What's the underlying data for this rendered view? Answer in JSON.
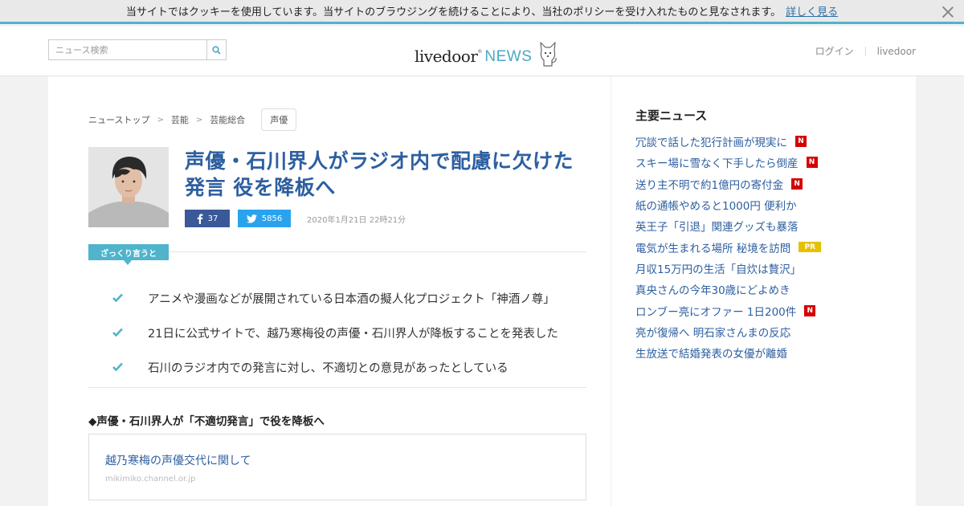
{
  "cookie": {
    "message": "当サイトではクッキーを使用しています。当サイトのブラウジングを続けることにより、当社のポリシーを受け入れたものと見なされます。",
    "link": "詳しく見る"
  },
  "header": {
    "search_placeholder": "ニュース検索",
    "logo_main": "livedoor",
    "logo_reg": "®",
    "logo_news": "NEWS",
    "login": "ログイン",
    "livedoor": "livedoor"
  },
  "breadcrumb": {
    "items": [
      "ニューストップ",
      "芸能",
      "芸能総合"
    ],
    "separator": ">",
    "tag": "声優"
  },
  "article": {
    "title": "声優・石川界人がラジオ内で配慮に欠けた発言 役を降板へ",
    "fb_count": "37",
    "tw_count": "5856",
    "date": "2020年1月21日 22時21分",
    "summary_label": "ざっくり言うと",
    "summary": [
      "アニメや漫画などが展開されている日本酒の擬人化プロジェクト「神酒ノ尊」",
      "21日に公式サイトで、越乃寒梅役の声優・石川界人が降板することを発表した",
      "石川のラジオ内での発言に対し、不適切との意見があったとしている"
    ],
    "subhead": "◆声優・石川界人が「不適切発言」で役を降板へ",
    "link_title": "越乃寒梅の声優交代に関して",
    "link_source": "mikimiko.channel.or.jp"
  },
  "sidebar": {
    "heading": "主要ニュース",
    "items": [
      {
        "label": "冗談で話した犯行計画が現実に",
        "badge": "N"
      },
      {
        "label": "スキー場に雪なく下手したら倒産",
        "badge": "N"
      },
      {
        "label": "送り主不明で約1億円の寄付金",
        "badge": "N"
      },
      {
        "label": "紙の通帳やめると1000円 便利か",
        "badge": ""
      },
      {
        "label": "英王子「引退」関連グッズも暴落",
        "badge": ""
      },
      {
        "label": "電気が生まれる場所 秘境を訪問",
        "badge": "PR"
      },
      {
        "label": "月収15万円の生活「自炊は贅沢」",
        "badge": ""
      },
      {
        "label": "真央さんの今年30歳にどよめき",
        "badge": ""
      },
      {
        "label": "ロンブー亮にオファー 1日200件",
        "badge": "N"
      },
      {
        "label": "亮が復帰へ 明石家さんまの反応",
        "badge": ""
      },
      {
        "label": "生放送で結婚発表の女優が離婚",
        "badge": ""
      }
    ]
  },
  "colors": {
    "accent": "#4fb4cc",
    "link": "#2d5fa0",
    "facebook": "#3b5998",
    "twitter": "#2aa3ef",
    "new_badge": "#d50000",
    "pr_badge": "#e6c100"
  }
}
